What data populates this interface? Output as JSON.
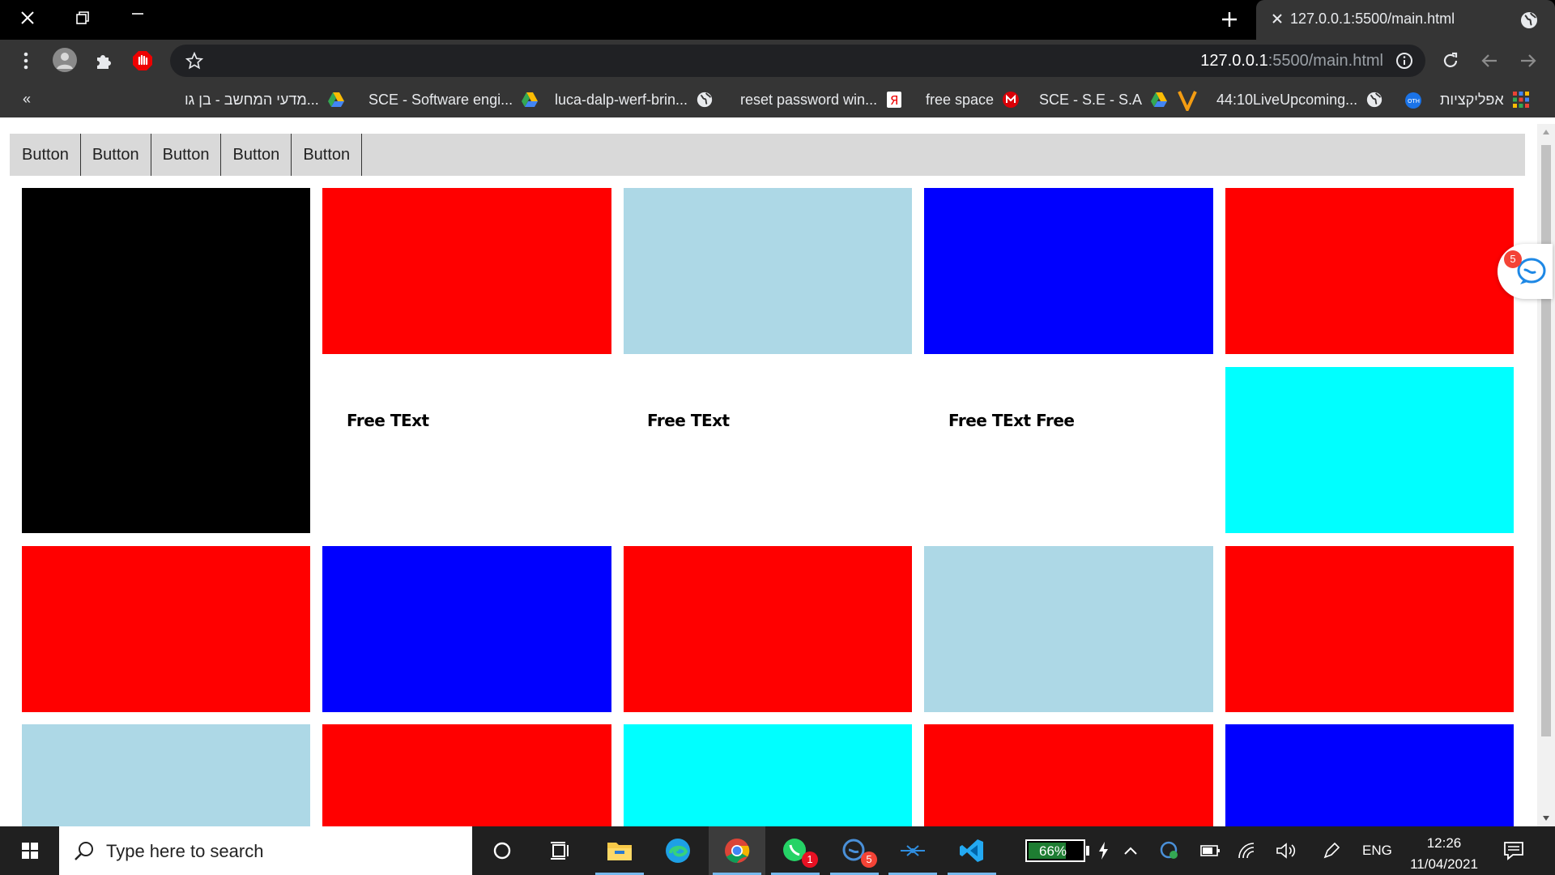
{
  "browser": {
    "tab": {
      "title": "127.0.0.1:5500/main.html"
    },
    "url": {
      "host": "127.0.0.1",
      "path": ":5500/main.html"
    },
    "bookmarks": [
      {
        "label": "אפליקציות",
        "icon": "apps-grid-icon"
      },
      {
        "label": "44:10LiveUpcoming...",
        "icon": "globe-icon"
      },
      {
        "label": "SCE - S.E - S.A",
        "icon": "google-drive-icon"
      },
      {
        "label": "free space",
        "icon": "mega-icon"
      },
      {
        "label": "reset password win...",
        "icon": "yandex-icon"
      },
      {
        "label": "luca-dalp-werf-brin...",
        "icon": "globe-icon"
      },
      {
        "label": "SCE - Software engi...",
        "icon": "google-drive-icon"
      },
      {
        "label": "מדעי המחשב - בן גו...",
        "icon": "google-drive-icon"
      }
    ],
    "bookmarks_overflow": "«"
  },
  "page": {
    "buttons": [
      "Button",
      "Button",
      "Button",
      "Button",
      "Button"
    ],
    "tiles": [
      {
        "color": "#000000"
      },
      {
        "color": "#ff0000"
      },
      {
        "color": "#add8e6"
      },
      {
        "color": "#0000ff"
      },
      {
        "color": "#ff0000"
      },
      {
        "color": "#00ffff"
      },
      {
        "color": "#ff0000"
      },
      {
        "color": "#0000ff"
      },
      {
        "color": "#ff0000"
      },
      {
        "color": "#add8e6"
      },
      {
        "color": "#ff0000"
      },
      {
        "color": "#add8e6"
      },
      {
        "color": "#ff0000"
      },
      {
        "color": "#00ffff"
      },
      {
        "color": "#ff0000"
      },
      {
        "color": "#0000ff"
      }
    ],
    "free_texts": [
      "Free TExt",
      "Free TExt",
      "Free TExt Free"
    ],
    "chat_badge": "5"
  },
  "taskbar": {
    "search_placeholder": "Type here to search",
    "battery": "66%",
    "language": "ENG",
    "time": "12:26",
    "date": "11/04/2021",
    "whatsapp_badge": "1",
    "app_badge": "5"
  }
}
